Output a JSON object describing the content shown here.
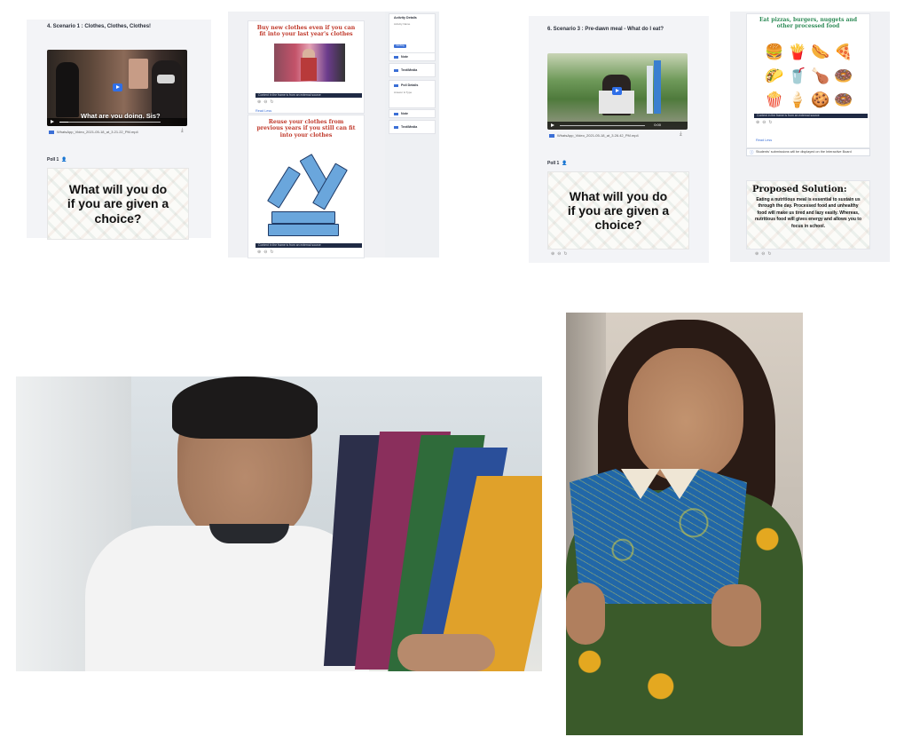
{
  "scenario1": {
    "title": "4. Scenario 1 : Clothes, Clothes, Clothes!",
    "video_caption": "What are you doing, Sis?",
    "video_file": "WhatsApp_Video_2021-05-18_at_3.21.22_PM.mp4",
    "poll_label": "Poll 1",
    "poll_question": "What will you do if you are given a choice?"
  },
  "scenario1_slides": {
    "slide1_heading": "Buy new clothes even if you can fit into your last year's clothes",
    "slide2_heading": "Reuse your clothes from previous years if you still can fit into your clothes",
    "source_text": "Content in the frame is from an external source",
    "link_text": "Read Less"
  },
  "sidebar": {
    "activity_details": "Activity Details",
    "activity_sub": "Activity Name",
    "pill": "Clothing",
    "note_label": "Note",
    "text_media": "Text/Media",
    "poll_details": "Poll Details",
    "poll_sub": "Answer & Type",
    "note_label_2": "Note",
    "text_media_2": "Text/Media"
  },
  "scenario3": {
    "title": "6. Scenario 3 : Pre-dawn meal - What do I eat?",
    "video_time": "0:00",
    "video_file": "WhatsApp_Video_2021-05-18_at_3.26.42_PM.mp4",
    "poll_label": "Poll 1",
    "poll_question": "What will you do if you are given a choice?"
  },
  "scenario3_slides": {
    "food_heading": "Eat pizzas, burgers, nuggets and other processed food",
    "foods": [
      "🍔",
      "🍟",
      "🌭",
      "🍕",
      "🌮",
      "🥤",
      "🍗",
      "🍩",
      "🍿",
      "🍦",
      "🍪",
      "🍩"
    ],
    "source_text": "Content in the frame is from an external source",
    "link_text": "Read Less",
    "notice": "Students' submissions will be displayed on the Interactive Board",
    "proposed_title": "Proposed Solution:",
    "proposed_body": "Eating a nutritious meal is essential to sustain us through the day. Processed food and unhealthy food will make us tired and lazy easily. Whereas, nutritious food will gives energy and allows you to focus in school."
  },
  "icons": [
    "user-icon",
    "play-icon",
    "download-icon",
    "video-file-icon",
    "zoom-in-icon",
    "zoom-out-icon",
    "refresh-icon",
    "info-icon"
  ],
  "colors": {
    "accent": "#3b6fd6",
    "slide_red": "#c0392b",
    "slide_green": "#2e8b57",
    "denim": "#6aa6dc"
  }
}
